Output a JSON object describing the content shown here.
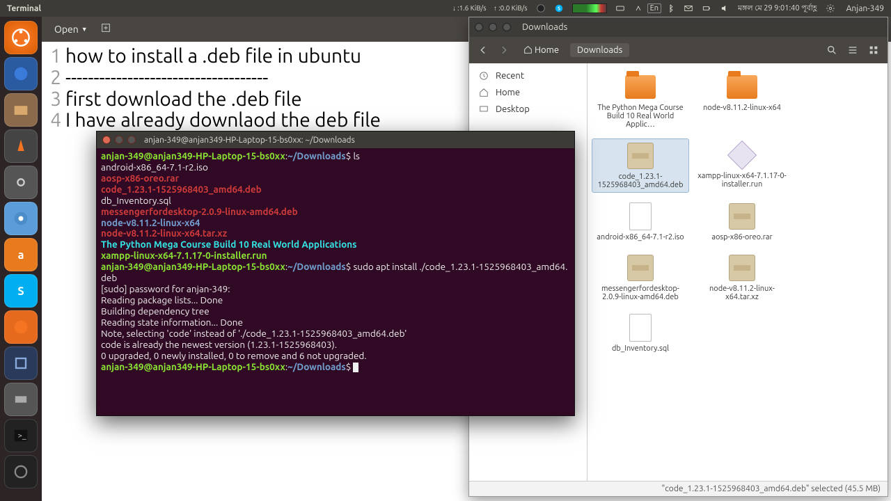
{
  "panel": {
    "app_title": "Terminal",
    "net_down": "↓ :1.6 KiB/s",
    "net_up": "↑ :0.0 KiB/s",
    "lang": "En",
    "clock": "মঙ্গল মে 29 9:01:40 পূর্বাহ্ণ",
    "user": "Anjan-349"
  },
  "editor": {
    "open": "Open",
    "lines": [
      "how to install a .deb file in ubuntu",
      "------------------------------------",
      "first download the .deb file",
      "I have already downlaod  the deb file"
    ]
  },
  "nautilus": {
    "title": "Downloads",
    "home": "Home",
    "crumb_active": "Downloads",
    "sidebar": [
      {
        "icon": "recent",
        "label": "Recent"
      },
      {
        "icon": "home",
        "label": "Home"
      },
      {
        "icon": "desktop",
        "label": "Desktop"
      }
    ],
    "files": [
      {
        "name": "The Python Mega Course Build 10 Real World Applic…",
        "type": "folder"
      },
      {
        "name": "node-v8.11.2-linux-x64",
        "type": "folder"
      },
      {
        "name": "code_1.23.1-1525968403_amd64.deb",
        "type": "package",
        "selected": true
      },
      {
        "name": "xampp-linux-x64-7.1.17-0-installer.run",
        "type": "diamond"
      },
      {
        "name": "android-x86_64-7.1-r2.iso",
        "type": "doc"
      },
      {
        "name": "aosp-x86-oreo.rar",
        "type": "package"
      },
      {
        "name": "messengerfordesktop-2.0.9-linux-amd64.deb",
        "type": "package"
      },
      {
        "name": "node-v8.11.2-linux-x64.tar.xz",
        "type": "package"
      },
      {
        "name": "db_Inventory.sql",
        "type": "doc"
      }
    ],
    "status": "\"code_1.23.1-1525968403_amd64.deb\" selected (45.5 MB)"
  },
  "terminal": {
    "title": "anjan-349@anjan349-HP-Laptop-15-bs0xx: ~/Downloads",
    "prompt_user": "anjan-349@anjan349-HP-Laptop-15-bs0xx",
    "prompt_path": "~/Downloads",
    "cmd1": "ls",
    "ls": {
      "iso": "android-x86_64-7.1-r2.iso",
      "rar": "aosp-x86-oreo.rar",
      "code": "code_1.23.1-1525968403_amd64.deb",
      "sql": "db_Inventory.sql",
      "mess": "messengerfordesktop-2.0.9-linux-amd64.deb",
      "node_dir": "node-v8.11.2-linux-x64",
      "node_tar": "node-v8.11.2-linux-x64.tar.xz",
      "python": "The Python Mega Course Build 10 Real World Applications",
      "xampp": "xampp-linux-x64-7.1.17-0-installer.run"
    },
    "cmd2": "sudo apt install ./code_1.23.1-1525968403_amd64.deb",
    "out": [
      "[sudo] password for anjan-349:",
      "Reading package lists... Done",
      "Building dependency tree",
      "Reading state information... Done",
      "Note, selecting 'code' instead of './code_1.23.1-1525968403_amd64.deb'",
      "code is already the newest version (1.23.1-1525968403).",
      "0 upgraded, 0 newly installed, 0 to remove and 6 not upgraded."
    ]
  }
}
